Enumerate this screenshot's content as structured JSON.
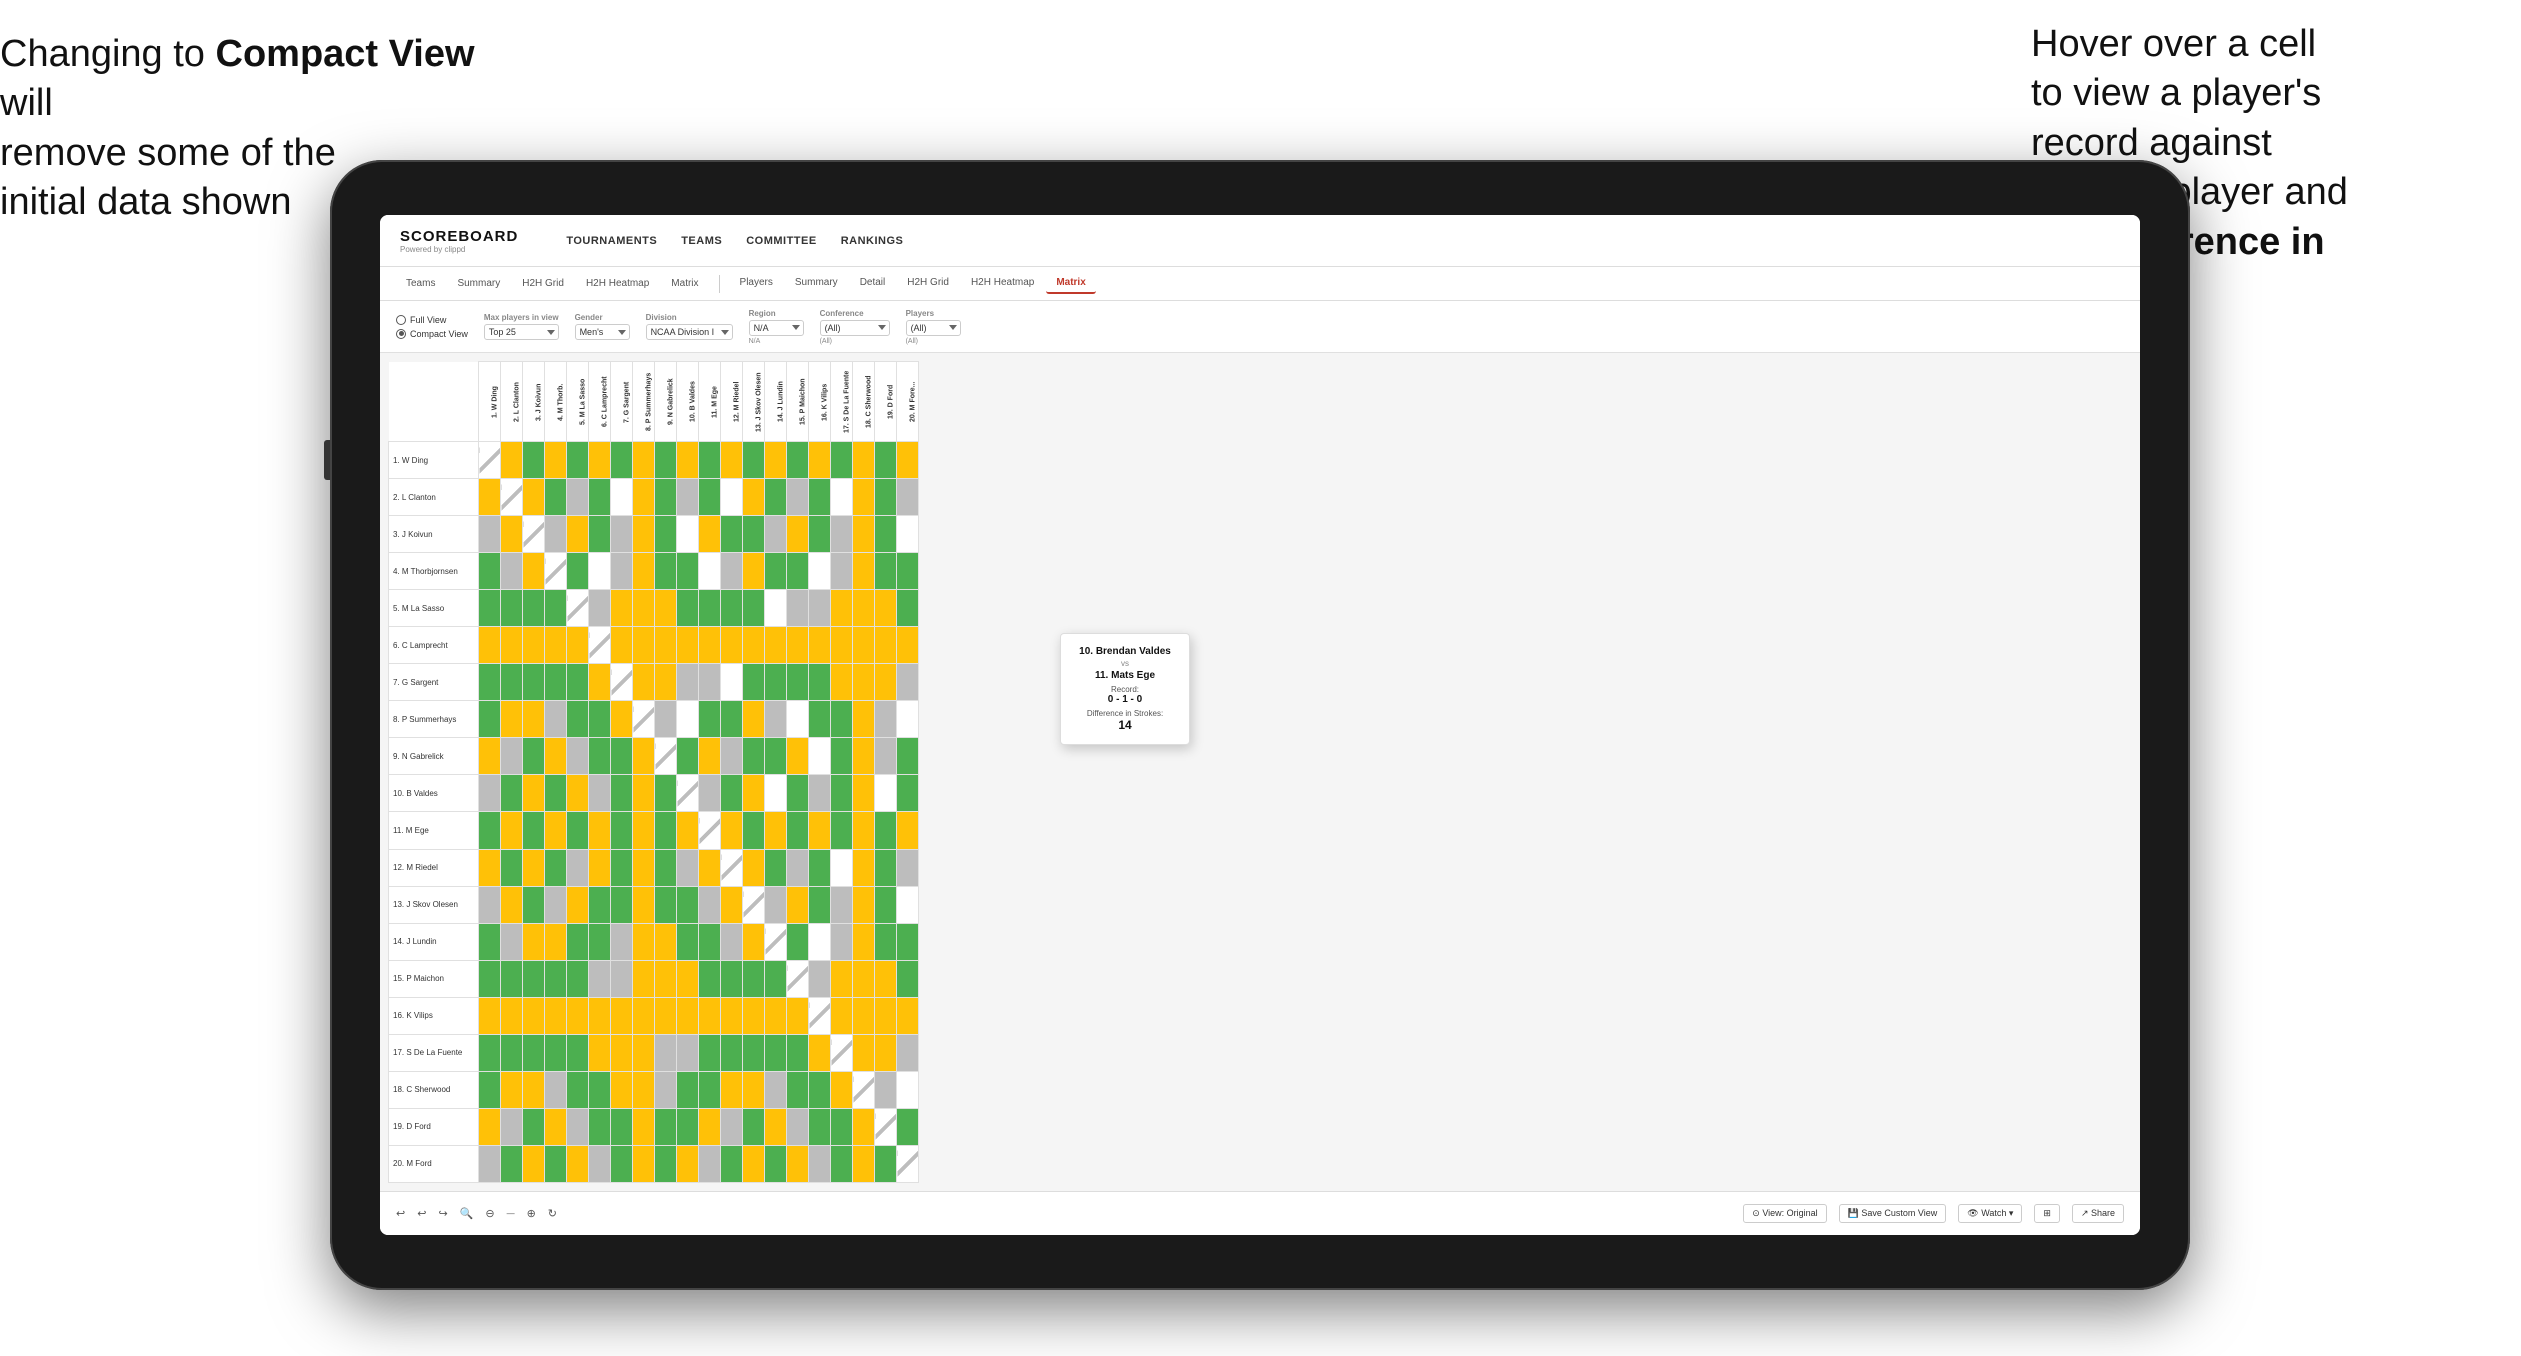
{
  "annotations": {
    "left": "Changing to Compact View will remove some of the initial data shown",
    "left_bold": "Compact View",
    "right": "Hover over a cell to view a player's record against another player and the Difference in Strokes",
    "right_bold": "Difference in Strokes"
  },
  "app": {
    "logo": "SCOREBOARD",
    "logo_sub": "Powered by clippd",
    "nav": [
      "TOURNAMENTS",
      "TEAMS",
      "COMMITTEE",
      "RANKINGS"
    ],
    "sub_tabs_left": [
      "Teams",
      "Summary",
      "H2H Grid",
      "H2H Heatmap",
      "Matrix"
    ],
    "sub_tabs_right": [
      "Players",
      "Summary",
      "Detail",
      "H2H Grid",
      "H2H Heatmap",
      "Matrix"
    ],
    "active_tab": "Matrix"
  },
  "filters": {
    "view_options": [
      "Full View",
      "Compact View"
    ],
    "selected_view": "Compact View",
    "max_players_label": "Max players in view",
    "max_players_value": "Top 25",
    "gender_label": "Gender",
    "gender_value": "Men's",
    "division_label": "Division",
    "division_value": "NCAA Division I",
    "region_label": "Region",
    "region_value": "N/A",
    "conference_label": "Conference",
    "conference_value": "(All)",
    "players_label": "Players",
    "players_value": "(All)"
  },
  "matrix": {
    "row_headers": [
      "1. W Ding",
      "2. L Clanton",
      "3. J Koivun",
      "4. M Thorbjornsen",
      "5. M La Sasso",
      "6. C Lamprecht",
      "7. G Sargent",
      "8. P Summerhays",
      "9. N Gabrelick",
      "10. B Valdes",
      "11. M Ege",
      "12. M Riedel",
      "13. J Skov Olesen",
      "14. J Lundin",
      "15. P Maichon",
      "16. K Vilips",
      "17. S De La Fuente",
      "18. C Sherwood",
      "19. D Ford",
      "20. M Ford"
    ],
    "col_headers": [
      "1. W Ding",
      "2. L Clanton",
      "3. J Koivun",
      "4. M Thorb",
      "5. M La Sasso",
      "6. C Lamprecht",
      "7. G Sargent",
      "8. P Summerhays",
      "9. N Gabrelick",
      "10. B Valdes",
      "11. M Ege",
      "12. M Riedel",
      "13. J Skov Olesen",
      "14. J Lundin",
      "15. P Maichon",
      "16. K Vilips",
      "17. S De La Fuente",
      "18. C Sherwood",
      "19. D Ford",
      "20. M Fore..."
    ]
  },
  "tooltip": {
    "player1": "10. Brendan Valdes",
    "vs": "vs",
    "player2": "11. Mats Ege",
    "record_label": "Record:",
    "record": "0 - 1 - 0",
    "diff_label": "Difference in Strokes:",
    "diff": "14"
  },
  "toolbar": {
    "undo": "↩",
    "redo": "↪",
    "zoom_out": "−",
    "zoom_in": "+",
    "view_original": "View: Original",
    "save_custom": "Save Custom View",
    "watch": "Watch ▾",
    "share": "Share"
  }
}
